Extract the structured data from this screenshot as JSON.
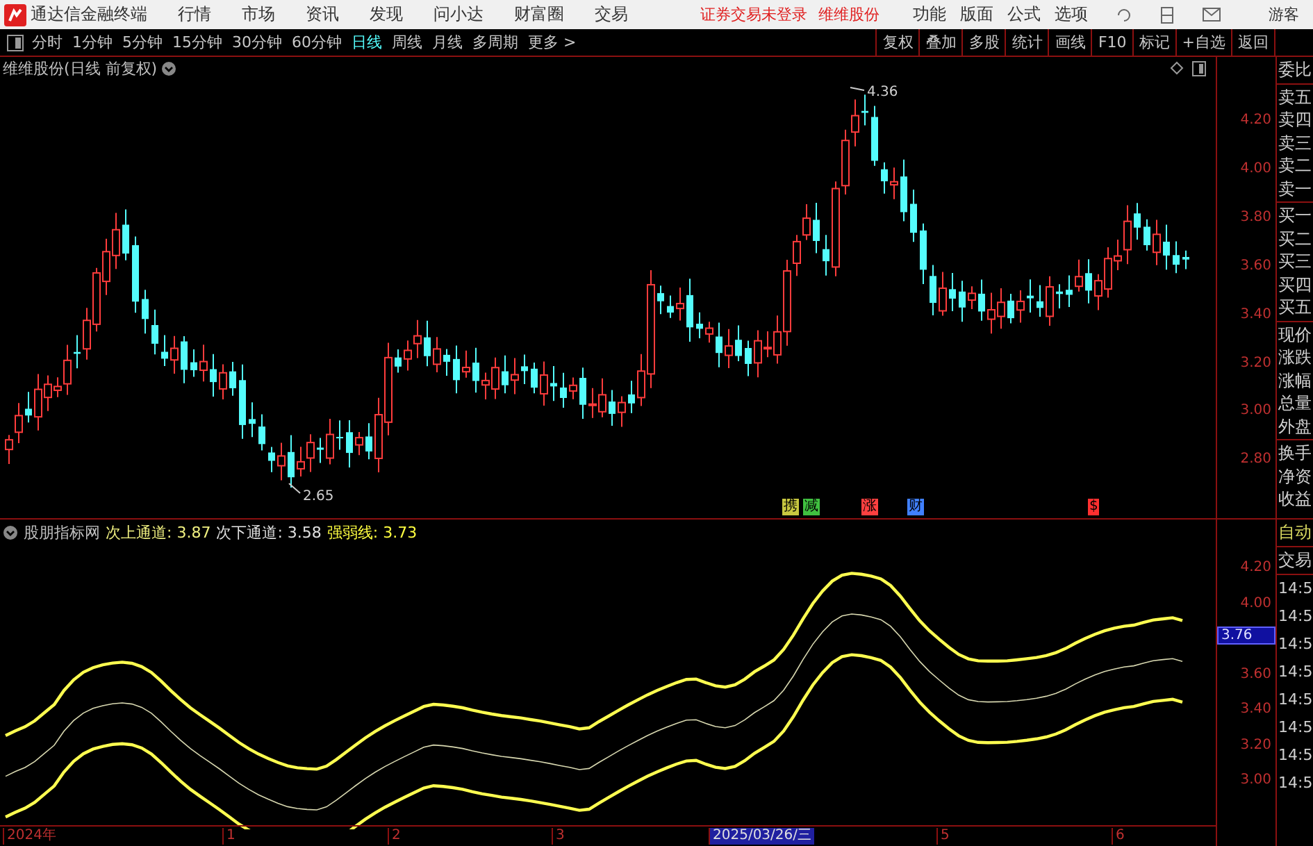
{
  "app": {
    "title": "通达信金融终端",
    "menu": [
      "行情",
      "市场",
      "资讯",
      "发现",
      "问小达",
      "财富圈",
      "交易"
    ],
    "notices": [
      "证券交易未登录",
      "维维股份"
    ],
    "tools": [
      "功能",
      "版面",
      "公式",
      "选项"
    ],
    "user": "游客"
  },
  "periods": [
    {
      "label": "分时",
      "selected": false
    },
    {
      "label": "1分钟",
      "selected": false
    },
    {
      "label": "5分钟",
      "selected": false
    },
    {
      "label": "15分钟",
      "selected": false
    },
    {
      "label": "30分钟",
      "selected": false
    },
    {
      "label": "60分钟",
      "selected": false
    },
    {
      "label": "日线",
      "selected": true
    },
    {
      "label": "周线",
      "selected": false
    },
    {
      "label": "月线",
      "selected": false
    },
    {
      "label": "多周期",
      "selected": false
    },
    {
      "label": "更多 >",
      "selected": false
    }
  ],
  "actions": [
    "复权",
    "叠加",
    "多股",
    "统计",
    "画线",
    "F10",
    "标记",
    "+自选",
    "返回"
  ],
  "main_chart": {
    "title": "维维股份(日线 前复权)",
    "y_ticks": [
      "4.20",
      "4.00",
      "3.80",
      "3.60",
      "3.40",
      "3.20",
      "3.00",
      "2.80"
    ],
    "high_label": "4.36",
    "low_label": "2.65",
    "events": [
      {
        "label": "携",
        "color": "#c8c840"
      },
      {
        "label": "减",
        "color": "#40c040"
      },
      {
        "label": "涨",
        "color": "#ff4040"
      },
      {
        "label": "财",
        "color": "#4080ff"
      },
      {
        "label": "$",
        "color": "#ff3030"
      }
    ]
  },
  "indicator": {
    "name": "股朋指标网",
    "readings": [
      {
        "label": "次上通道:",
        "value": "3.87",
        "color": "#f0f080"
      },
      {
        "label": "次下通道:",
        "value": "3.58",
        "color": "#e0e0e0"
      },
      {
        "label": "强弱线:",
        "value": "3.73",
        "color": "#ffff40"
      }
    ],
    "y_ticks": [
      "4.20",
      "4.00",
      "3.60",
      "3.40",
      "3.20",
      "3.00"
    ],
    "current_price": "3.76"
  },
  "quote_panel": {
    "groups": [
      [
        "委比"
      ],
      [
        "卖五",
        "卖四",
        "卖三",
        "卖二",
        "卖一"
      ],
      [
        "买一",
        "买二",
        "买三",
        "买四",
        "买五"
      ],
      [
        "现价",
        "涨跌",
        "涨幅",
        "总量",
        "外盘"
      ],
      [
        "换手",
        "净资",
        "收益"
      ]
    ]
  },
  "trade_panel": {
    "mode": "自动",
    "title": "交易",
    "times": [
      "14:5",
      "14:5",
      "14:5",
      "14:5",
      "14:5",
      "14:5",
      "14:5",
      "14:5"
    ]
  },
  "time_axis": [
    {
      "label": "2024年",
      "selected": false
    },
    {
      "label": "1",
      "selected": false
    },
    {
      "label": "2",
      "selected": false
    },
    {
      "label": "3",
      "selected": false
    },
    {
      "label": "2025/03/26/三",
      "selected": true
    },
    {
      "label": "5",
      "selected": false
    },
    {
      "label": "6",
      "selected": false
    }
  ]
}
